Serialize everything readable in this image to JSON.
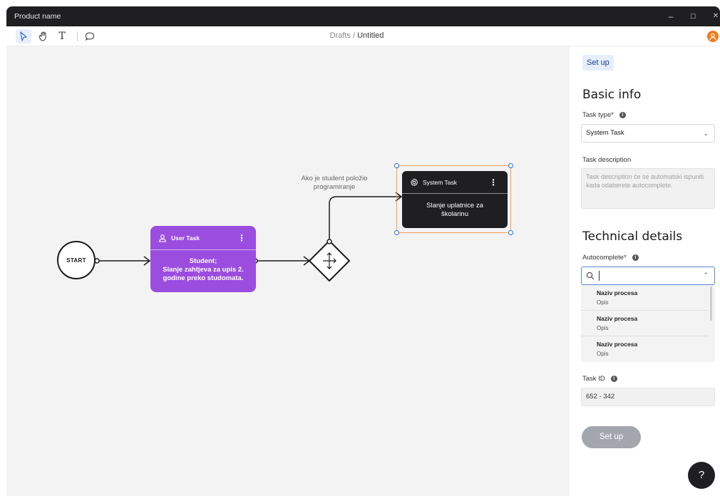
{
  "window": {
    "app_title": "Product name",
    "controls": {
      "minimize": "–",
      "maximize": "☐",
      "close": "✕"
    }
  },
  "toolbar": {
    "tools": [
      {
        "name": "select",
        "icon": "cursor-arrow-icon",
        "active": true
      },
      {
        "name": "hand",
        "icon": "hand-icon",
        "active": false
      },
      {
        "name": "text",
        "icon": "text-icon",
        "glyph": "T",
        "active": false
      },
      {
        "name": "comment",
        "icon": "comment-icon",
        "active": false
      }
    ],
    "breadcrumb": {
      "parent": "Drafts",
      "separator": " / ",
      "current": "Untitled"
    },
    "avatar_icon": "user-avatar-icon"
  },
  "canvas": {
    "start_node": {
      "label": "START"
    },
    "user_task": {
      "type_label": "User Task",
      "icon": "user-icon",
      "body_lines": [
        "Student;",
        "Slanje zahtjeva za upis 2.",
        "godine preko studomata."
      ],
      "color": "#9b4de0"
    },
    "gateway": {
      "icon": "gateway-split-icon"
    },
    "gateway_label_lines": [
      "Ako je student položio",
      "programiranje"
    ],
    "system_task": {
      "type_label": "System Task",
      "icon": "gear-icon",
      "body_lines": [
        "Slanje uplatnice za",
        "školarinu"
      ],
      "color": "#1f1f22"
    },
    "selection_color": "#f0a050",
    "handle_color": "#2f6bea"
  },
  "panel": {
    "setup_chip": "Set up",
    "basic_info": {
      "title": "Basic info",
      "task_type_label": "Task type*",
      "task_type_value": "System Task",
      "task_description_label": "Task description",
      "task_description_placeholder": "Task description će se automatski ispuniti kada odaberete autocomplete."
    },
    "technical_details": {
      "title": "Technical details",
      "autocomplete_label": "Autocomplete*",
      "search_value": "",
      "options": [
        {
          "title": "Naziv procesa",
          "subtitle": "Opis"
        },
        {
          "title": "Naziv procesa",
          "subtitle": "Opis"
        },
        {
          "title": "Naziv procesa",
          "subtitle": "Opis"
        }
      ],
      "task_id_label": "Task ID",
      "task_id_value": "652 - 342"
    },
    "setup_button": "Set up",
    "help_button": "?"
  }
}
